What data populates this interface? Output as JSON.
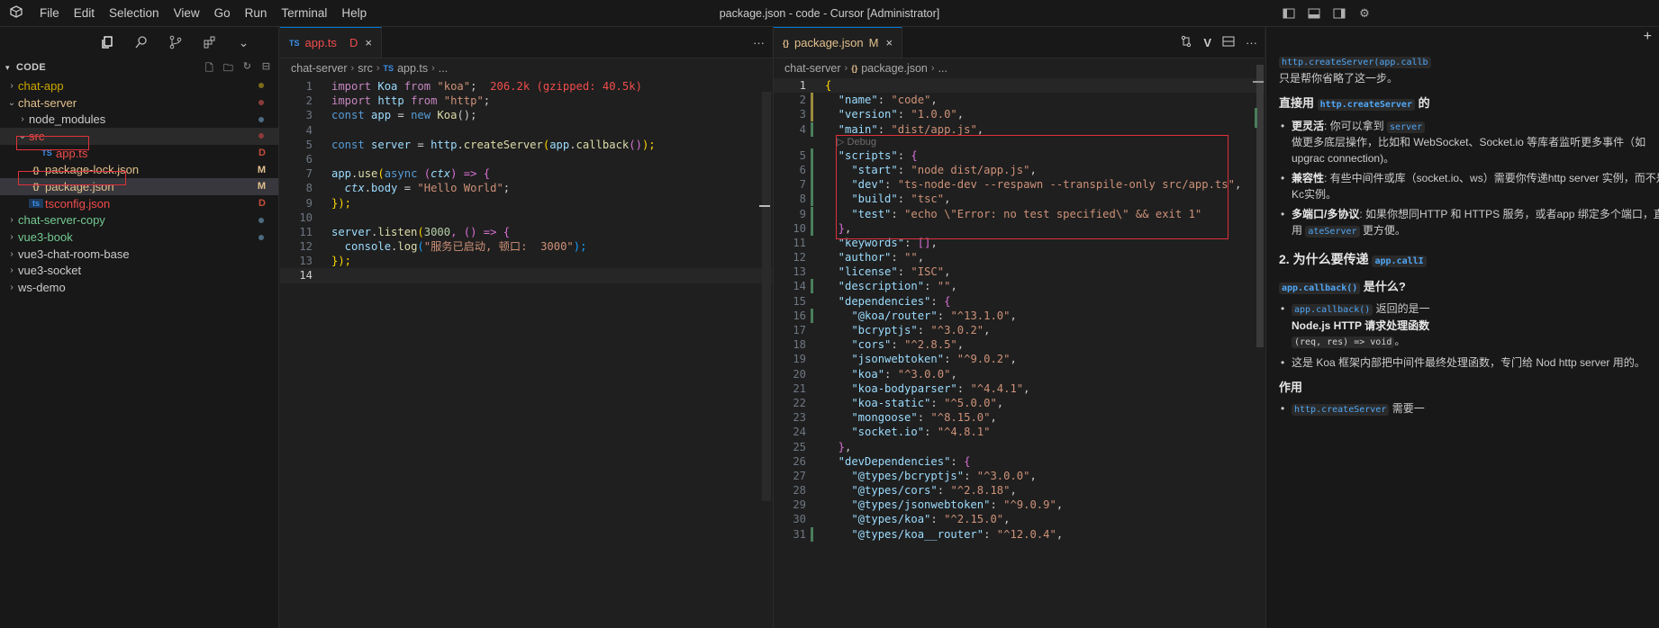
{
  "titlebar": {
    "menus": [
      "File",
      "Edit",
      "Selection",
      "View",
      "Go",
      "Run",
      "Terminal",
      "Help"
    ],
    "title": "package.json - code - Cursor [Administrator]"
  },
  "explorer": {
    "section": "CODE",
    "items": [
      {
        "label": "chat-app",
        "kind": "folder",
        "depth": 0,
        "expanded": false,
        "color": "#cca700",
        "status": "dot",
        "statusColor": "#7a6a1a"
      },
      {
        "label": "chat-server",
        "kind": "folder",
        "depth": 0,
        "expanded": true,
        "color": "#e2c08d",
        "status": "dot",
        "statusColor": "#8c3a3a"
      },
      {
        "label": "node_modules",
        "kind": "folder",
        "depth": 1,
        "expanded": false,
        "color": "#cccccc",
        "status": "dot",
        "statusColor": "#4d6a80"
      },
      {
        "label": "src",
        "kind": "folder",
        "depth": 1,
        "expanded": true,
        "color": "#f14c4c",
        "status": "dot",
        "statusColor": "#8c3a3a"
      },
      {
        "label": "app.ts",
        "kind": "ts",
        "depth": 2,
        "color": "#f14c4c",
        "status": "D",
        "statusColor": "#c74e39"
      },
      {
        "label": "package-lock.json",
        "kind": "json",
        "depth": 1,
        "color": "#e2c08d",
        "status": "M",
        "statusColor": "#e2c08d"
      },
      {
        "label": "package.json",
        "kind": "json",
        "depth": 1,
        "color": "#e2c08d",
        "status": "M",
        "statusColor": "#e2c08d",
        "selected": true
      },
      {
        "label": "tsconfig.json",
        "kind": "tsconfig",
        "depth": 1,
        "color": "#f14c4c",
        "status": "D",
        "statusColor": "#c74e39"
      },
      {
        "label": "chat-server-copy",
        "kind": "folder",
        "depth": 0,
        "expanded": false,
        "color": "#73c991",
        "status": "dot",
        "statusColor": "#4d6a80"
      },
      {
        "label": "vue3-book",
        "kind": "folder",
        "depth": 0,
        "expanded": false,
        "color": "#73c991",
        "status": "dot",
        "statusColor": "#4d6a80"
      },
      {
        "label": "vue3-chat-room-base",
        "kind": "folder",
        "depth": 0,
        "expanded": false,
        "color": "#cccccc",
        "status": "",
        "statusColor": ""
      },
      {
        "label": "vue3-socket",
        "kind": "folder",
        "depth": 0,
        "expanded": false,
        "color": "#cccccc",
        "status": "",
        "statusColor": ""
      },
      {
        "label": "ws-demo",
        "kind": "folder",
        "depth": 0,
        "expanded": false,
        "color": "#cccccc",
        "status": "",
        "statusColor": ""
      }
    ]
  },
  "editor1": {
    "tab": {
      "icon": "TS",
      "label": "app.ts",
      "status": "D",
      "close": "×"
    },
    "breadcrumb": [
      "chat-server",
      "src",
      "app.ts",
      "..."
    ],
    "breadcrumb_icon": "TS",
    "lines": [
      "1",
      "2",
      "3",
      "4",
      "5",
      "6",
      "7",
      "8",
      "9",
      "10",
      "11",
      "12",
      "13",
      "14"
    ],
    "code": {
      "l1a": "import",
      "l1b": " Koa ",
      "l1c": "from",
      "l1d": " \"koa\"",
      "l1e": ";",
      "l1hint": "206.2k (gzipped: 40.5k)",
      "l2a": "import",
      "l2b": " http ",
      "l2c": "from",
      "l2d": " \"http\"",
      "l2e": ";",
      "l3a": "const",
      "l3b": " app ",
      "l3c": "= ",
      "l3d": "new",
      "l3e": " Koa",
      "l3f": "();",
      "l5a": "const",
      "l5b": " server ",
      "l5c": "= ",
      "l5d": "http",
      "l5e": ".",
      "l5f": "createServer",
      "l5g": "(",
      "l5h": "app",
      "l5i": ".",
      "l5j": "callback",
      "l5k": "()",
      "l5l": ");",
      "l7a": "app",
      "l7b": ".",
      "l7c": "use",
      "l7d": "(",
      "l7e": "async",
      "l7f": " (",
      "l7g": "ctx",
      "l7h": ") => {",
      "l8a": "  ctx",
      "l8b": ".",
      "l8c": "body",
      "l8d": " = ",
      "l8e": "\"Hello World\"",
      "l8f": ";",
      "l9a": "});",
      "l11a": "server",
      "l11b": ".",
      "l11c": "listen",
      "l11d": "(",
      "l11e": "3000",
      "l11f": ", () => {",
      "l12a": "  console",
      "l12b": ".",
      "l12c": "log",
      "l12d": "(",
      "l12e": "\"服务已启动, 顿口:  3000\"",
      "l12f": ");",
      "l13a": "});"
    }
  },
  "editor2": {
    "tab": {
      "icon": "{}",
      "label": "package.json",
      "status": "M",
      "close": "×"
    },
    "breadcrumb": [
      "chat-server",
      "package.json",
      "..."
    ],
    "breadcrumb_icon": "{}",
    "codelens": "▷ Debug",
    "lines": [
      {
        "n": "1",
        "t": [
          [
            "br1",
            "{"
          ]
        ]
      },
      {
        "n": "2",
        "t": [
          [
            "v",
            "  \"name\""
          ],
          [
            "p",
            ": "
          ],
          [
            "s",
            "\"code\""
          ],
          [
            "p",
            ","
          ]
        ]
      },
      {
        "n": "3",
        "t": [
          [
            "v",
            "  \"version\""
          ],
          [
            "p",
            ": "
          ],
          [
            "s",
            "\"1.0.0\""
          ],
          [
            "p",
            ","
          ]
        ]
      },
      {
        "n": "4",
        "t": [
          [
            "v",
            "  \"main\""
          ],
          [
            "p",
            ": "
          ],
          [
            "s",
            "\"dist/app.js\""
          ],
          [
            "p",
            ","
          ]
        ]
      },
      {
        "n": "5",
        "t": [
          [
            "v",
            "  \"scripts\""
          ],
          [
            "p",
            ": "
          ],
          [
            "br2",
            "{"
          ]
        ]
      },
      {
        "n": "6",
        "t": [
          [
            "v",
            "    \"start\""
          ],
          [
            "p",
            ": "
          ],
          [
            "s",
            "\"node dist/app.js\""
          ],
          [
            "p",
            ","
          ]
        ]
      },
      {
        "n": "7",
        "t": [
          [
            "v",
            "    \"dev\""
          ],
          [
            "p",
            ": "
          ],
          [
            "s",
            "\"ts-node-dev --respawn --transpile-only src/app.ts\""
          ],
          [
            "p",
            ","
          ]
        ]
      },
      {
        "n": "8",
        "t": [
          [
            "v",
            "    \"build\""
          ],
          [
            "p",
            ": "
          ],
          [
            "s",
            "\"tsc\""
          ],
          [
            "p",
            ","
          ]
        ]
      },
      {
        "n": "9",
        "t": [
          [
            "v",
            "    \"test\""
          ],
          [
            "p",
            ": "
          ],
          [
            "s",
            "\"echo \\\"Error: no test specified\\\" && exit 1\""
          ]
        ]
      },
      {
        "n": "10",
        "t": [
          [
            "br2",
            "  }"
          ],
          [
            "p",
            ","
          ]
        ]
      },
      {
        "n": "11",
        "t": [
          [
            "v",
            "  \"keywords\""
          ],
          [
            "p",
            ": "
          ],
          [
            "br2",
            "[]"
          ],
          [
            "p",
            ","
          ]
        ]
      },
      {
        "n": "12",
        "t": [
          [
            "v",
            "  \"author\""
          ],
          [
            "p",
            ": "
          ],
          [
            "s",
            "\"\""
          ],
          [
            "p",
            ","
          ]
        ]
      },
      {
        "n": "13",
        "t": [
          [
            "v",
            "  \"license\""
          ],
          [
            "p",
            ": "
          ],
          [
            "s",
            "\"ISC\""
          ],
          [
            "p",
            ","
          ]
        ]
      },
      {
        "n": "14",
        "t": [
          [
            "v",
            "  \"description\""
          ],
          [
            "p",
            ": "
          ],
          [
            "s",
            "\"\""
          ],
          [
            "p",
            ","
          ]
        ]
      },
      {
        "n": "15",
        "t": [
          [
            "v",
            "  \"dependencies\""
          ],
          [
            "p",
            ": "
          ],
          [
            "br2",
            "{"
          ]
        ]
      },
      {
        "n": "16",
        "t": [
          [
            "v",
            "    \"@koa/router\""
          ],
          [
            "p",
            ": "
          ],
          [
            "s",
            "\"^13.1.0\""
          ],
          [
            "p",
            ","
          ]
        ]
      },
      {
        "n": "17",
        "t": [
          [
            "v",
            "    \"bcryptjs\""
          ],
          [
            "p",
            ": "
          ],
          [
            "s",
            "\"^3.0.2\""
          ],
          [
            "p",
            ","
          ]
        ]
      },
      {
        "n": "18",
        "t": [
          [
            "v",
            "    \"cors\""
          ],
          [
            "p",
            ": "
          ],
          [
            "s",
            "\"^2.8.5\""
          ],
          [
            "p",
            ","
          ]
        ]
      },
      {
        "n": "19",
        "t": [
          [
            "v",
            "    \"jsonwebtoken\""
          ],
          [
            "p",
            ": "
          ],
          [
            "s",
            "\"^9.0.2\""
          ],
          [
            "p",
            ","
          ]
        ]
      },
      {
        "n": "20",
        "t": [
          [
            "v",
            "    \"koa\""
          ],
          [
            "p",
            ": "
          ],
          [
            "s",
            "\"^3.0.0\""
          ],
          [
            "p",
            ","
          ]
        ]
      },
      {
        "n": "21",
        "t": [
          [
            "v",
            "    \"koa-bodyparser\""
          ],
          [
            "p",
            ": "
          ],
          [
            "s",
            "\"^4.4.1\""
          ],
          [
            "p",
            ","
          ]
        ]
      },
      {
        "n": "22",
        "t": [
          [
            "v",
            "    \"koa-static\""
          ],
          [
            "p",
            ": "
          ],
          [
            "s",
            "\"^5.0.0\""
          ],
          [
            "p",
            ","
          ]
        ]
      },
      {
        "n": "23",
        "t": [
          [
            "v",
            "    \"mongoose\""
          ],
          [
            "p",
            ": "
          ],
          [
            "s",
            "\"^8.15.0\""
          ],
          [
            "p",
            ","
          ]
        ]
      },
      {
        "n": "24",
        "t": [
          [
            "v",
            "    \"socket.io\""
          ],
          [
            "p",
            ": "
          ],
          [
            "s",
            "\"^4.8.1\""
          ]
        ]
      },
      {
        "n": "25",
        "t": [
          [
            "br2",
            "  }"
          ],
          [
            "p",
            ","
          ]
        ]
      },
      {
        "n": "26",
        "t": [
          [
            "v",
            "  \"devDependencies\""
          ],
          [
            "p",
            ": "
          ],
          [
            "br2",
            "{"
          ]
        ]
      },
      {
        "n": "27",
        "t": [
          [
            "v",
            "    \"@types/bcryptjs\""
          ],
          [
            "p",
            ": "
          ],
          [
            "s",
            "\"^3.0.0\""
          ],
          [
            "p",
            ","
          ]
        ]
      },
      {
        "n": "28",
        "t": [
          [
            "v",
            "    \"@types/cors\""
          ],
          [
            "p",
            ": "
          ],
          [
            "s",
            "\"^2.8.18\""
          ],
          [
            "p",
            ","
          ]
        ]
      },
      {
        "n": "29",
        "t": [
          [
            "v",
            "    \"@types/jsonwebtoken\""
          ],
          [
            "p",
            ": "
          ],
          [
            "s",
            "\"^9.0.9\""
          ],
          [
            "p",
            ","
          ]
        ]
      },
      {
        "n": "30",
        "t": [
          [
            "v",
            "    \"@types/koa\""
          ],
          [
            "p",
            ": "
          ],
          [
            "s",
            "\"^2.15.0\""
          ],
          [
            "p",
            ","
          ]
        ]
      },
      {
        "n": "31",
        "t": [
          [
            "v",
            "    \"@types/koa__router\""
          ],
          [
            "p",
            ": "
          ],
          [
            "s",
            "\"^12.0.4\""
          ],
          [
            "p",
            ","
          ]
        ]
      }
    ]
  },
  "chat": {
    "top_code": "http.createServer(app.callb",
    "top_text": "只是帮你省略了这一步。",
    "h1_pre": "直接用 ",
    "h1_code": "http.createServer",
    "h1_post": " 的",
    "bullets1": [
      {
        "bold": "更灵活",
        "text": ": 你可以拿到 ",
        "code": "server",
        "rest": "做更多底层操作，比如和 WebSocket、Socket.io 等库者监听更多事件（如 upgrac connection)。"
      },
      {
        "bold": "兼容性",
        "text": ": 有些中间件或库（socket.io、ws）需要你传递http server 实例，而不是 Kc实例。",
        "code": "",
        "rest": ""
      },
      {
        "bold": "多端口/多协议",
        "text": ": 如果你想同HTTP 和 HTTPS 服务，或者app 绑定多个端口，直接用 ",
        "code": "ateServer",
        "rest": " 更方便。"
      }
    ],
    "h2_pre": "2. 为什么要传递 ",
    "h2_code": "app.callI",
    "h3_code": "app.callback()",
    "h3_post": " 是什么?",
    "bullets2": [
      {
        "code": "app.callback()",
        "text": " 返回的是一",
        "bold": "Node.js HTTP 请求处理函数",
        "code2": "(req, res) => void",
        "rest": "。"
      },
      {
        "text": "这是 Koa 框架内部把中间件最终处理函数，专门给 Nod http server 用的。"
      }
    ],
    "h4": "作用",
    "last_code": "http.createServer",
    "last_text": " 需要一"
  }
}
